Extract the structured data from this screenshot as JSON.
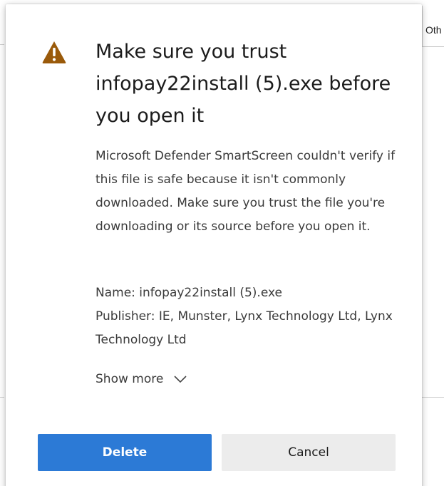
{
  "background": {
    "tab_fragment_text": "Oth"
  },
  "dialog": {
    "icon": "warning-triangle-icon",
    "icon_color": "#9a5a0a",
    "title": "Make sure you trust infopay22install (5).exe before you open it",
    "description": "Microsoft Defender SmartScreen couldn't verify if this file is safe because it isn't commonly downloaded. Make sure you trust the file you're downloading or its source before you open it.",
    "name_line": "Name: infopay22install (5).exe",
    "publisher_line": "Publisher: IE, Munster, Lynx Technology Ltd, Lynx Technology Ltd",
    "show_more_label": "Show more",
    "show_more_icon": "chevron-down-icon",
    "delete_label": "Delete",
    "cancel_label": "Cancel",
    "accent_color": "#2c7ad6"
  }
}
